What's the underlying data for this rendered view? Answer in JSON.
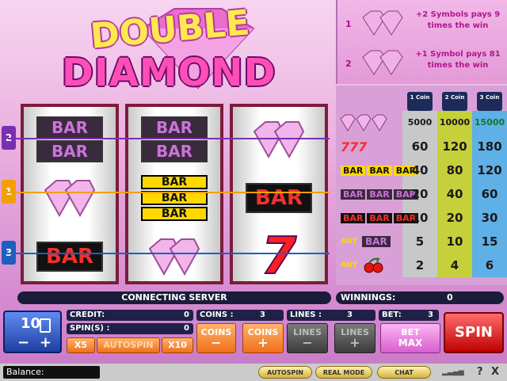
{
  "logo": {
    "line1": "DOUBLE",
    "line2": "DIAMOND"
  },
  "bonus": [
    {
      "number": "1",
      "text": "+2 Symbols pays 9 times the win"
    },
    {
      "number": "2",
      "text": "+1 Symbol pays 81 times the win"
    }
  ],
  "paylines": [
    {
      "number": "2",
      "color": "#7a2fb3"
    },
    {
      "number": "1",
      "color": "#f2a000"
    },
    {
      "number": "3",
      "color": "#1f5fbf"
    }
  ],
  "reels": {
    "reel1": [
      "BAR BAR",
      "DIAMOND",
      "BAR"
    ],
    "reel2": [
      "BAR BAR",
      "BAR BAR BAR",
      "DIAMOND"
    ],
    "reel3": [
      "DIAMOND",
      "BAR",
      "7"
    ]
  },
  "paytable": {
    "headers": [
      "1 Coin",
      "2 Coin",
      "3 Coin"
    ],
    "rows": [
      {
        "symbol": "DIAMOND DIAMOND DIAMOND",
        "values": [
          "5000",
          "10000",
          "15000"
        ]
      },
      {
        "symbol": "777",
        "values": [
          "60",
          "120",
          "180"
        ]
      },
      {
        "symbol": "BAR BAR BAR (3BAR)",
        "values": [
          "40",
          "80",
          "120"
        ]
      },
      {
        "symbol": "BAR BAR BAR (2BAR)",
        "values": [
          "20",
          "40",
          "60"
        ]
      },
      {
        "symbol": "BAR BAR BAR (1BAR)",
        "values": [
          "10",
          "20",
          "30"
        ]
      },
      {
        "symbol": "ANY BAR",
        "values": [
          "5",
          "10",
          "15"
        ]
      },
      {
        "symbol": "ANY CHERRY",
        "values": [
          "2",
          "4",
          "6"
        ]
      }
    ],
    "any_label": "ANY",
    "bar_label": "BAR",
    "seven_label": "777"
  },
  "status": {
    "message": "CONNECTING SERVER",
    "winnings_label": "WINNINGS:",
    "winnings_value": "0"
  },
  "controls": {
    "coin_selector": "10",
    "credit_label": "CREDIT:",
    "credit_value": "0",
    "spins_label": "SPIN(S) :",
    "spins_value": "0",
    "x5_label": "X5",
    "autospin_label": "AUTOSPIN",
    "x10_label": "X10",
    "coins_label": "COINS :",
    "coins_value": "3",
    "lines_label": "LINES :",
    "lines_value": "3",
    "bet_label": "BET:",
    "bet_value": "3",
    "coins_btn": "COINS",
    "lines_btn": "LINES",
    "betmax_line1": "BET",
    "betmax_line2": "MAX",
    "spin_label": "SPIN",
    "minus": "−",
    "plus": "+"
  },
  "footer": {
    "balance_label": "Balance:",
    "autospin": "AUTOSPIN",
    "realmode": "REAL MODE",
    "chat": "CHAT",
    "help": "?",
    "close": "X"
  }
}
